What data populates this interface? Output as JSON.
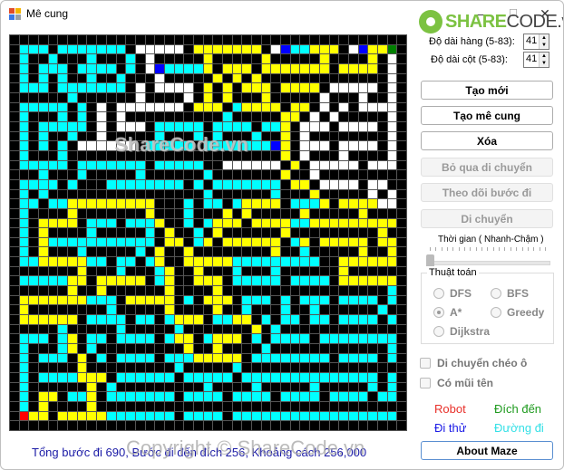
{
  "window": {
    "title": "Mê cung",
    "minimize": "—",
    "maximize": "☐",
    "close": "✕"
  },
  "logo": {
    "part1": "SHARE",
    "part2": "CODE.vn"
  },
  "settings": {
    "rows_label": "Độ dài hàng (5-83):",
    "rows_value": "41",
    "cols_label": "Độ dài cột (5-83):",
    "cols_value": "41"
  },
  "buttons": {
    "new": "Tạo mới",
    "generate": "Tạo mê cung",
    "clear": "Xóa",
    "skip": "Bỏ qua di chuyển",
    "trace": "Theo dõi bước đi",
    "move": "Di chuyển",
    "about": "About Maze"
  },
  "speed": {
    "label": "Thời gian ( Nhanh-Chậm )",
    "value_fraction": 0
  },
  "algorithm": {
    "title": "Thuật toán",
    "options": [
      "DFS",
      "BFS",
      "A*",
      "Greedy",
      "Dijkstra"
    ],
    "selected": "A*"
  },
  "options": {
    "diagonal": "Di chuyển chéo ô",
    "arrows": "Có mũi tên",
    "diagonal_checked": false,
    "arrows_checked": false
  },
  "legend": {
    "robot": {
      "label": "Robot",
      "color": "#e8302a"
    },
    "goal": {
      "label": "Đích đến",
      "color": "#1e9a1e"
    },
    "tried": {
      "label": "Đi thử",
      "color": "#1a1ae6"
    },
    "path": {
      "label": "Đường đi",
      "color": "#33e0e6"
    }
  },
  "status": "Tổng bước đi 690, Bước đi đến đích 256, Khoảng cách 256,000",
  "watermarks": {
    "maze": "ShareCode.vn",
    "footer": "Copyright © ShareCode.vn"
  },
  "maze": {
    "rows": 41,
    "cols": 41,
    "cell_legend": {
      "k": "wall",
      "w": "open",
      "c": "visited",
      "y": "final-path",
      "b": "tried",
      "r": "robot",
      "g": "goal"
    },
    "grid": [
      "kkkkkkkkkkkkkkkkkkkkkkkkkkkkkkkkkkkkkkkkk",
      "kccckccccccckwwwwwkyyyyyyykwbccyyykwbyygk",
      "kckkckkkckkkckwkkkkkykkkkkykkkkkykkkkykwk",
      "kckccckcccckckwbccccykyyykyyyyyyykyyyykwk",
      "kckckckkckkckkkwkkkkkykykykkkkkkkkkkkkkwk",
      "kccckccccccckwkwwwwkykykyyykyyyykwwwwwkwk",
      "kkkkkkckkkkkkwkkkkwkykykkkykkkkkwkkkwkkwk",
      "kccccckckwkwwwwwwwkyyykcyyyykyykwkwkwwwwk",
      "kckkkckckwkwkkkkkkkkkkckkkkkyykwkwkkkkkwk",
      "kckccccckwkwwwkccccckcccckccykwwwkwwwwkwk",
      "kckckkckkwkkkkkckkkckckkkckkykwkkkkkkkkwk",
      "kckckckwwwwwwkccccckcccccccbykwwwkwwwwkwk",
      "kckkkckkkkkkkkkkkkkkkkkkkkkkykwkkkwkkkkwk",
      "kccccckccccccckccccckkwwwwwwkykwwwwwkwwwk",
      "kkkckkkckkkkkckkkkkkckkkkkkkykkwkkkkkkkkk",
      "kcccckckkkcccccccckckccccccckyykwwwwkwwkk",
      "kckckkkkkkkkkkkkkkkkckkkkkkckkkykkkkkwkwk",
      "kcckccyyyyyyyyykkkckcckcyyyykcccykyyyywwk",
      "kckkkkykkkkkkkykkkckkkykykkkkkykkkkkykkkk",
      "kckyyyykccckcccykkckcyyykyyyyccyyyyyyyyyk",
      "kckykkkkckkkkkckykkckykkkkkkykkkkkkkkkykk",
      "kckyccccccccccckyykcykyyyyyykcykyyyyykyyk",
      "kckykkkckkkkkckykkykkkkkkkkykkckkkkkykkyk",
      "kccyyyyycckcckcykkyyyyyccccccccckkyyyyyyk",
      "kkkkkkkykkkckkkcykkykkkckkkckkkkkkykkkkkk",
      "kcccccyykyyyyykcykkyyykccccckcccckyyyyyyk",
      "kkkkkkykkykkkkkkykkkkykkkkkkkkkkkkkkkkkck",
      "kyyyyyyyccckyyyyykckyyykccckckccckcccckck",
      "kykkkkkkkkckkkkkykkkkykkckkkckkckkkkkkckk",
      "kyyyyyykcccckcckcyyykccyykckcckcckcccckck",
      "kkkkkckkkkkckkkkkckkkkkkkykckkkkkkkkkkkkk",
      "kccckcykcckcccckcyykcyyykckcccckcccccccck",
      "kckkkcykckkkkkkkkkykkykkkkckkkkkkkkkkkkck",
      "kckccckykckcccckcccyyyyykcccccccckcccckck",
      "kckkkkkykkkkkkkkkckkkkkckkkkkkkkkkkkkkkkk",
      "kckccccyyykcccccckccccckcccccccccccccckck",
      "kckkkkkkykckkkkkkkkkckkkkckkkkkckkkkkckck",
      "kckyykccykccccccckcccckcccckcccckcccckcck",
      "kckykkkkykkkkkkkkkkkkkkkkkkkkkkkkkkkkkkkk",
      "kryykyyyyyccccccckcccckccccccccccccccccck",
      "kkkkkkkkkkkkkkkkkkkkkkkkkkkkkkkkkkkkkkkkk"
    ]
  }
}
